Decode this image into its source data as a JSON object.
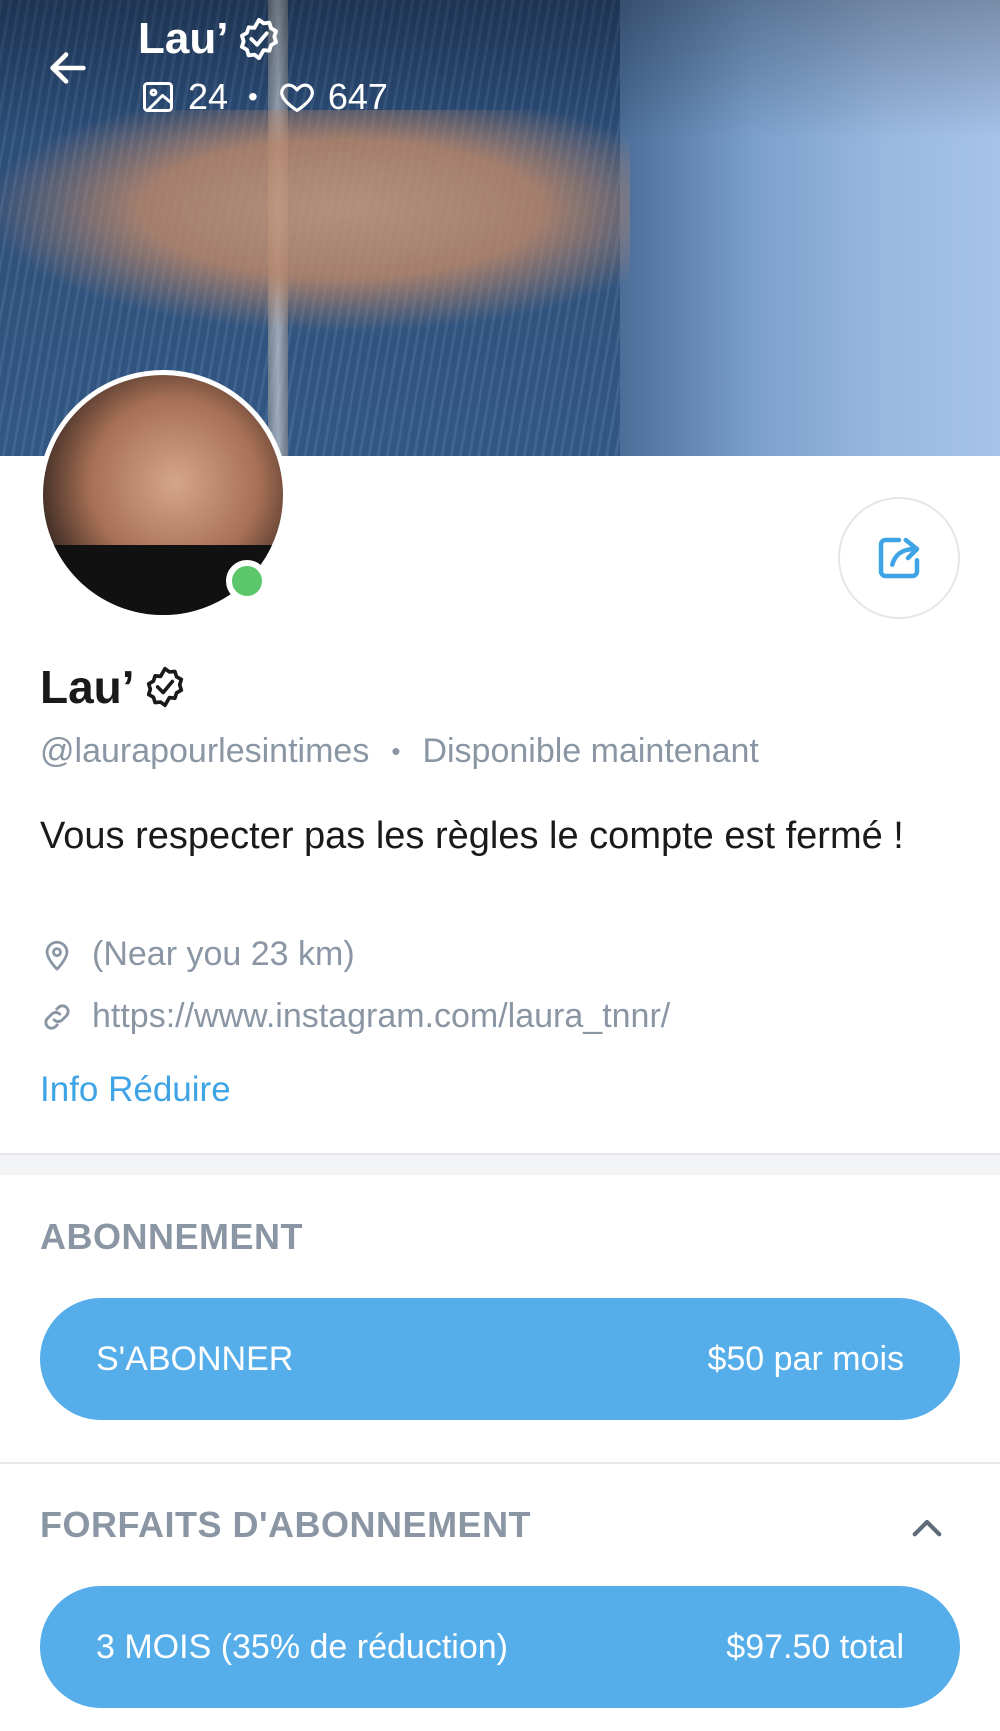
{
  "header": {
    "title": "Lau’",
    "media_count": "24",
    "likes_count": "647",
    "separator": "•"
  },
  "profile": {
    "name": "Lau’",
    "handle": "@laurapourlesintimes",
    "separator": "•",
    "status": "Disponible maintenant",
    "bio": "Vous respecter pas les règles le compte est fermé !",
    "location": "(Near you 23 km)",
    "link": "https://www.instagram.com/laura_tnnr/",
    "info_toggle": "Info Réduire"
  },
  "subscription": {
    "section_title": "ABONNEMENT",
    "button_label": "S'ABONNER",
    "button_price": "$50 par mois"
  },
  "plans": {
    "section_title": "FORFAITS D'ABONNEMENT",
    "items": [
      {
        "label": "3 MOIS (35% de réduction)",
        "price": "$97.50 total"
      }
    ]
  },
  "colors": {
    "accent": "#55aee9",
    "link": "#3fa4e6",
    "muted": "#8a96a3",
    "online": "#5bc76a"
  },
  "icons": {
    "back": "arrow-left-icon",
    "verified": "verified-badge-icon",
    "media": "image-icon",
    "likes": "heart-icon",
    "share": "share-icon",
    "location": "location-pin-icon",
    "link": "link-icon",
    "collapse": "chevron-up-icon"
  }
}
